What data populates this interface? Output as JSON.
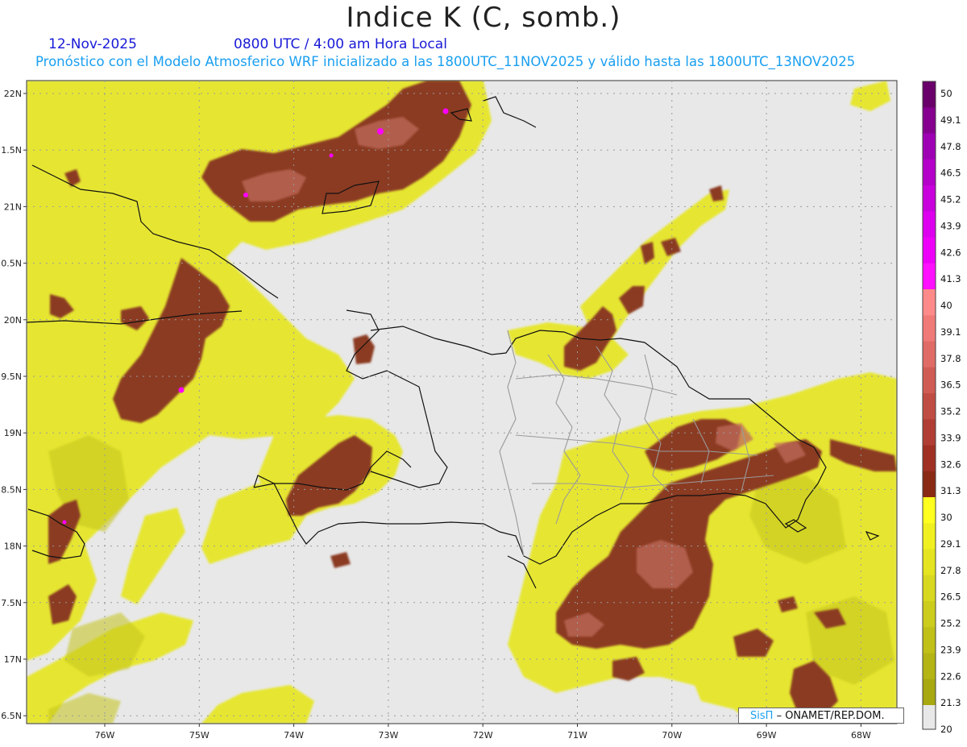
{
  "title": "Indice K (C, somb.)",
  "date": "12-Nov-2025",
  "time": "0800 UTC / 4:00 am Hora Local",
  "forecast_line": "Pronóstico con el Modelo Atmosferico WRF inicializado a las 1800UTC_11NOV2025 y válido hasta las  1800UTC_13NOV2025",
  "lat_labels": [
    "22N",
    "1.5N",
    "21N",
    "0.5N",
    "20N",
    "9.5N",
    "19N",
    "8.5N",
    "18N",
    "7.5N",
    "17N",
    "6.5N"
  ],
  "lon_labels": [
    "76W",
    "75W",
    "74W",
    "73W",
    "72W",
    "71W",
    "70W",
    "69W",
    "68W"
  ],
  "colorbar": {
    "labels": [
      "50",
      "49.1",
      "47.8",
      "46.5",
      "45.2",
      "43.9",
      "42.6",
      "41.3",
      "40",
      "39.1",
      "37.8",
      "36.5",
      "35.2",
      "33.9",
      "32.6",
      "31.3",
      "30",
      "29.1",
      "27.8",
      "26.5",
      "25.2",
      "23.9",
      "22.6",
      "21.3",
      "20"
    ],
    "colors": [
      "#6a006a",
      "#85008e",
      "#9e00b4",
      "#b400c8",
      "#c800dc",
      "#dd00ee",
      "#ee00f8",
      "#ff10ff",
      "#ff8a8a",
      "#f07a78",
      "#e06b66",
      "#d05c55",
      "#c04d44",
      "#b03e34",
      "#a03024",
      "#8a2a14",
      "#ffff20",
      "#f0f020",
      "#e4e420",
      "#d8d820",
      "#cccc1c",
      "#c0c018",
      "#b4b414",
      "#a8a810"
    ],
    "bottom_color": "#e8e8e8"
  },
  "credit": {
    "brand": "SisΠ",
    "rest": "– ONAMET/REP.DOM."
  },
  "colors": {
    "ocean": "#e8e8e8",
    "yellow": "#eaea30",
    "brown": "#8b3a22",
    "pink": "#c8706a",
    "magenta": "#ff00ff"
  }
}
